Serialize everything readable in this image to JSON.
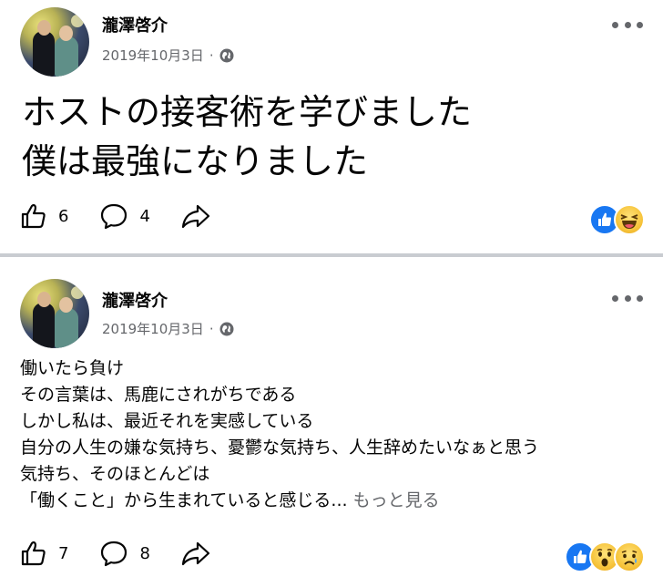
{
  "posts": [
    {
      "author": "瀧澤啓介",
      "date": "2019年10月3日",
      "separator": "·",
      "title_lines": [
        "ホストの接客術を学びました",
        "僕は最強になりました"
      ],
      "like_count": "6",
      "comment_count": "4",
      "reactions": [
        "like-icon",
        "haha-icon"
      ]
    },
    {
      "author": "瀧澤啓介",
      "date": "2019年10月3日",
      "separator": "·",
      "body_lines": [
        "働いたら負け",
        "その言葉は、馬鹿にされがちである",
        "しかし私は、最近それを実感している",
        "自分の人生の嫌な気持ち、憂鬱な気持ち、人生辞めたいなぁと思う",
        "気持ち、そのほとんどは",
        "「働くこと」から生まれていると感じる..."
      ],
      "see_more": "もっと見る",
      "like_count": "7",
      "comment_count": "8",
      "reactions": [
        "like-icon",
        "wow-icon",
        "sad-icon"
      ]
    }
  ],
  "colors": {
    "text": "#050505",
    "secondary": "#65676b",
    "like_blue": "#1877f2",
    "divider": "#c9ccd1"
  }
}
